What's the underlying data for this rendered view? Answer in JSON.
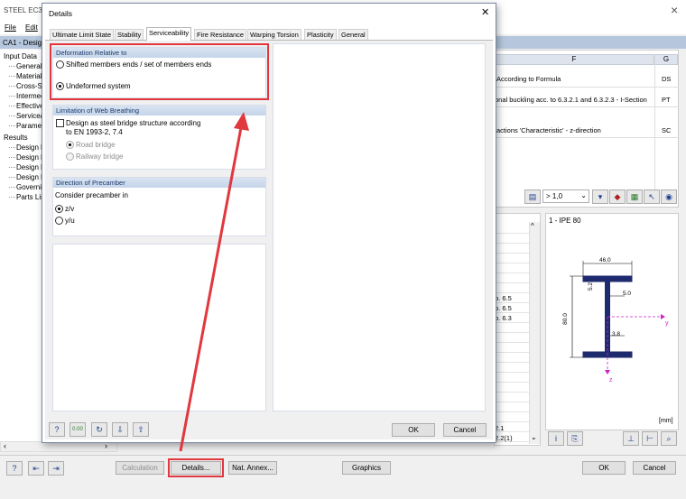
{
  "main_window": {
    "title": "STEEL EC3",
    "menu": [
      "File",
      "Edit"
    ],
    "case": "CA1 - Design",
    "close": "×"
  },
  "tree": {
    "input_header": "Input Data",
    "input_items": [
      "General",
      "Materials",
      "Cross-Se",
      "Intermed",
      "Effective",
      "Serviceab",
      "Paramet"
    ],
    "results_header": "Results",
    "results_items": [
      "Design b",
      "Design b",
      "Design b",
      "Design b",
      "Governi",
      "Parts Lis"
    ]
  },
  "table": {
    "col_f": "F",
    "col_g": "G",
    "rows": [
      {
        "f": "According to Formula",
        "g": "DS"
      },
      {
        "f": "onal buckling acc. to 6.3.2.1 and 6.3.2.3 - I-Section",
        "g": "PT"
      },
      {
        "f": "actions 'Characteristic' - z-direction",
        "g": "SC"
      }
    ]
  },
  "results_toolbar": {
    "ratio_select": "> 1,0"
  },
  "results_values": [
    "o. 6.5",
    "o. 6.5",
    "o. 6.3"
  ],
  "results_bottom": [
    "2.1",
    "2.2(1)"
  ],
  "section": {
    "title": "1 - IPE 80",
    "width_dim": "46.0",
    "flange_dim": "5.2",
    "web_dim": "5.0",
    "height_dim": "80.0",
    "tw_dim": "3.8",
    "axis_y": "y",
    "axis_z": "z",
    "unit": "[mm]"
  },
  "details_dialog": {
    "title": "Details",
    "close": "✕",
    "tabs": [
      "Ultimate Limit State",
      "Stability",
      "Serviceability",
      "Fire Resistance",
      "Warping Torsion",
      "Plasticity",
      "General"
    ],
    "active_tab": "Serviceability",
    "deformation": {
      "title": "Deformation Relative to",
      "option1": "Shifted members ends / set of members ends",
      "option2": "Undeformed system"
    },
    "web_breathing": {
      "title": "Limitation of Web Breathing",
      "check_line1": "Design as steel bridge structure according",
      "check_line2": "to EN 1993-2, 7.4",
      "road": "Road bridge",
      "rail": "Railway bridge"
    },
    "precamber": {
      "title": "Direction of Precamber",
      "label": "Consider precamber in",
      "opt1": "z/v",
      "opt2": "y/u"
    },
    "ok": "OK",
    "cancel": "Cancel"
  },
  "bottom_bar": {
    "calculation": "Calculation",
    "details": "Details...",
    "nat_annex": "Nat. Annex...",
    "graphics": "Graphics",
    "ok": "OK",
    "cancel": "Cancel"
  },
  "colors": {
    "highlight": "#e0383e",
    "accent": "#1f3f8f",
    "section_fill": "#1e2a6e"
  }
}
